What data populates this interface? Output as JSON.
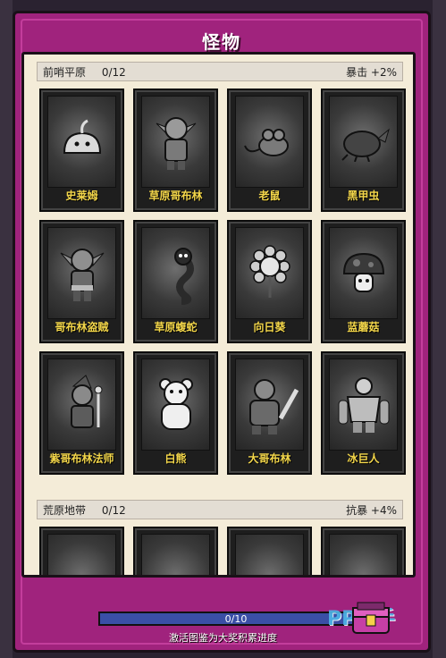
{
  "window": {
    "title": "怪物"
  },
  "sections": [
    {
      "name": "前哨平原",
      "progress": "0/12",
      "bonus": "暴击 +2%",
      "cards": [
        {
          "name": "史莱姆",
          "icon": "slime-icon"
        },
        {
          "name": "草原哥布林",
          "icon": "goblin-icon"
        },
        {
          "name": "老鼠",
          "icon": "rat-icon"
        },
        {
          "name": "黑甲虫",
          "icon": "beetle-icon"
        },
        {
          "name": "哥布林盗贼",
          "icon": "goblin-thief-icon"
        },
        {
          "name": "草原蝮蛇",
          "icon": "snake-icon"
        },
        {
          "name": "向日葵",
          "icon": "sunflower-icon"
        },
        {
          "name": "蓝蘑菇",
          "icon": "mushroom-icon"
        },
        {
          "name": "紫哥布林法师",
          "icon": "goblin-mage-icon"
        },
        {
          "name": "白熊",
          "icon": "bear-icon"
        },
        {
          "name": "大哥布林",
          "icon": "big-goblin-icon"
        },
        {
          "name": "冰巨人",
          "icon": "ice-giant-icon"
        }
      ]
    },
    {
      "name": "荒原地带",
      "progress": "0/12",
      "bonus": "抗暴 +4%",
      "cards": [
        {
          "name": "",
          "icon": "partial-monster-icon"
        },
        {
          "name": "",
          "icon": "partial-monster-icon"
        },
        {
          "name": "",
          "icon": "partial-monster-icon"
        },
        {
          "name": "",
          "icon": "partial-monster-icon"
        }
      ]
    }
  ],
  "footer": {
    "progress_text": "0/10",
    "progress_fraction": 0,
    "caption": "激活图鉴为大奖积累进度",
    "watermark": "PP助手"
  },
  "colors": {
    "frame": "#a0237d",
    "panel": "#f4ecd8",
    "card_name": "#f3d64a",
    "bar": "#3a4fa6"
  }
}
